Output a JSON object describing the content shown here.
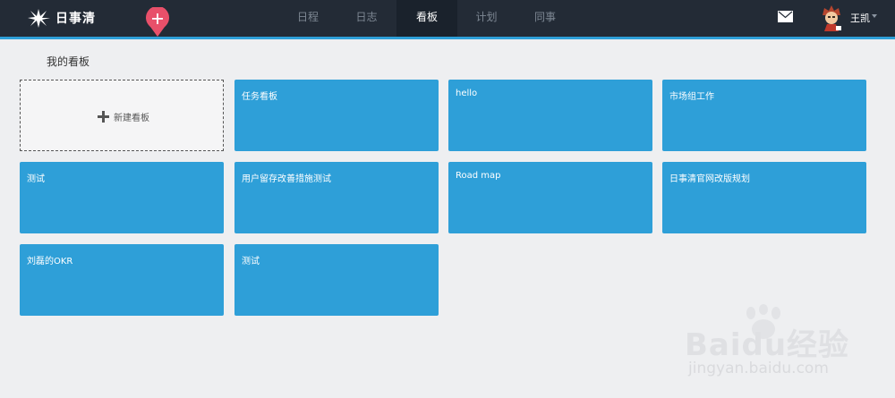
{
  "app": {
    "name": "日事清",
    "colors": {
      "topbar": "#232b36",
      "accent": "#2e9fd8",
      "card": "#2e9fd8",
      "page_bg": "#eeeff1",
      "add_button": "#e8506a"
    }
  },
  "nav": {
    "tabs": [
      {
        "label": "日程",
        "active": false
      },
      {
        "label": "日志",
        "active": false
      },
      {
        "label": "看板",
        "active": true
      },
      {
        "label": "计划",
        "active": false
      },
      {
        "label": "同事",
        "active": false
      }
    ]
  },
  "header": {
    "icons": [
      "logo-icon",
      "add-pin-icon",
      "mail-icon",
      "avatar",
      "chevron-down-icon"
    ],
    "user_name": "王凯"
  },
  "main": {
    "section_title": "我的看板",
    "new_board_label": "新建看板",
    "boards": [
      {
        "title": "任务看板"
      },
      {
        "title": "hello"
      },
      {
        "title": "市场组工作"
      },
      {
        "title": "测试"
      },
      {
        "title": "用户留存改善措施测试"
      },
      {
        "title": "Road map"
      },
      {
        "title": "日事清官网改版规划"
      },
      {
        "title": "刘磊的OKR"
      },
      {
        "title": "测试"
      }
    ]
  },
  "watermark": {
    "brand": "Baidu经验",
    "url": "jingyan.baidu.com"
  }
}
